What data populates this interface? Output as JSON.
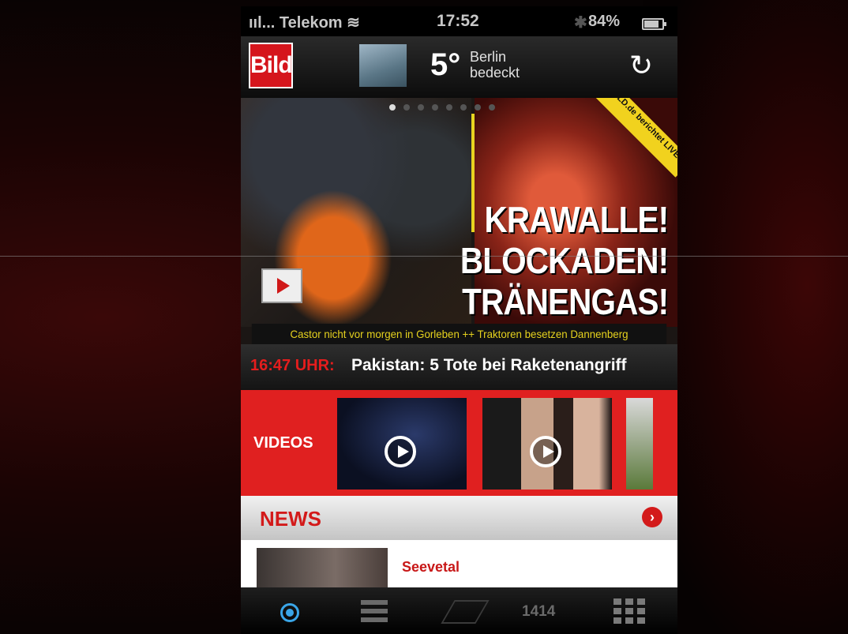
{
  "status_bar": {
    "carrier": "Telekom",
    "time": "17:52",
    "battery": "84%"
  },
  "header": {
    "logo": "Bild",
    "temperature": "5°",
    "city": "Berlin",
    "condition": "bedeckt"
  },
  "hero": {
    "page_count": 8,
    "active_page": 1,
    "live_badge": "BILD.de berichtet LIVE",
    "headline_lines": [
      "KRAWALLE!",
      "BLOCKADEN!",
      "TRÄNENGAS!"
    ],
    "teaser": "Castor nicht vor morgen in Gorleben ++ Traktoren besetzen Dannenberg"
  },
  "ticker": {
    "time": "16:47 UHR:",
    "text": "Pakistan: 5 Tote bei Raketenangriff"
  },
  "videos": {
    "label": "VIDEOS"
  },
  "news": {
    "title": "NEWS",
    "items": [
      {
        "title": "Seevetal"
      }
    ]
  },
  "tab_bar": {
    "count": "1414",
    "icons": [
      "live-icon",
      "list-icon",
      "stack-icon",
      "grid-icon"
    ],
    "active_color": "#3aa6e8"
  },
  "colors": {
    "brand_red": "#d5151c",
    "accent_yellow": "#e6d21e"
  }
}
